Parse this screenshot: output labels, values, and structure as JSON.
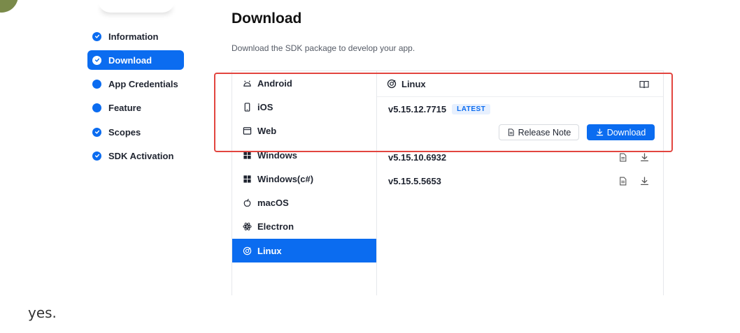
{
  "steps": [
    {
      "label": "Information",
      "state": "done"
    },
    {
      "label": "Download",
      "state": "active"
    },
    {
      "label": "App Credentials",
      "state": "pending"
    },
    {
      "label": "Feature",
      "state": "pending"
    },
    {
      "label": "Scopes",
      "state": "done"
    },
    {
      "label": "SDK Activation",
      "state": "done"
    }
  ],
  "header": {
    "title": "Download",
    "subtitle": "Download the SDK package to develop your app."
  },
  "platforms": [
    {
      "label": "Android",
      "icon": "android-icon"
    },
    {
      "label": "iOS",
      "icon": "phone-icon"
    },
    {
      "label": "Web",
      "icon": "browser-icon"
    },
    {
      "label": "Windows",
      "icon": "windows-icon"
    },
    {
      "label": "Windows(c#)",
      "icon": "windows-icon"
    },
    {
      "label": "macOS",
      "icon": "apple-icon"
    },
    {
      "label": "Electron",
      "icon": "electron-icon"
    },
    {
      "label": "Linux",
      "icon": "linux-icon",
      "active": true
    }
  ],
  "detail": {
    "title": "Linux",
    "versions": [
      {
        "version": "v5.15.12.7715",
        "badge": "LATEST"
      },
      {
        "version": "v5.15.10.6932"
      },
      {
        "version": "v5.15.5.5653"
      }
    ],
    "release_note_label": "Release Note",
    "download_label": "Download"
  },
  "footer": {
    "text": "yes."
  },
  "colors": {
    "accent": "#0b6cf0",
    "highlight": "#e2453f"
  }
}
